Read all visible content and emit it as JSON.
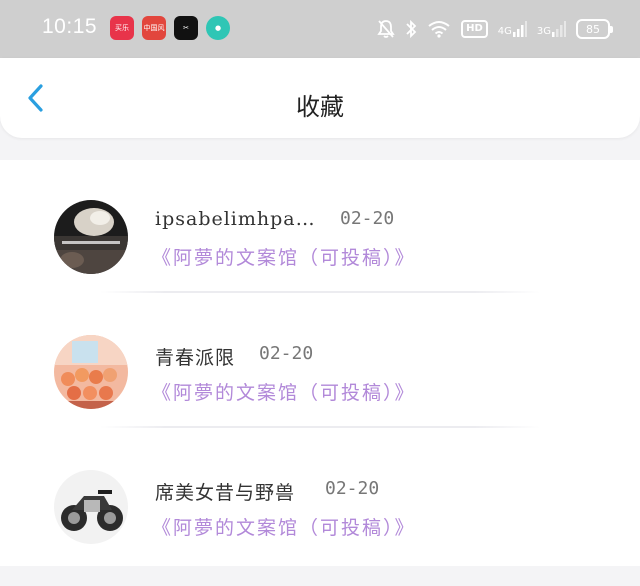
{
  "status_bar": {
    "time": "10:15",
    "apps": [
      {
        "icon": "video-app-icon",
        "label": "买乐"
      },
      {
        "icon": "news-app-icon",
        "label": "中国风"
      },
      {
        "icon": "capcut-app-icon",
        "label": "✂"
      },
      {
        "icon": "chat-app-icon",
        "label": "●"
      }
    ],
    "hd": "HD",
    "net1": "4G",
    "net2": "3G",
    "battery": "85"
  },
  "header": {
    "title": "收藏"
  },
  "favorites": [
    {
      "name": "ipsabelimhpa…",
      "date": "02-20",
      "group": "《阿夢的文案馆（可投稿）》"
    },
    {
      "name": "青春派限",
      "date": "02-20",
      "group": "《阿夢的文案馆（可投稿）》"
    },
    {
      "name": "席美女昔与野兽",
      "date": "02-20",
      "group": "《阿夢的文案馆（可投稿）》"
    }
  ],
  "colors": {
    "accent": "#2a9fe0",
    "group_text": "#b289d9",
    "status_bar": "#cfcfcf"
  }
}
